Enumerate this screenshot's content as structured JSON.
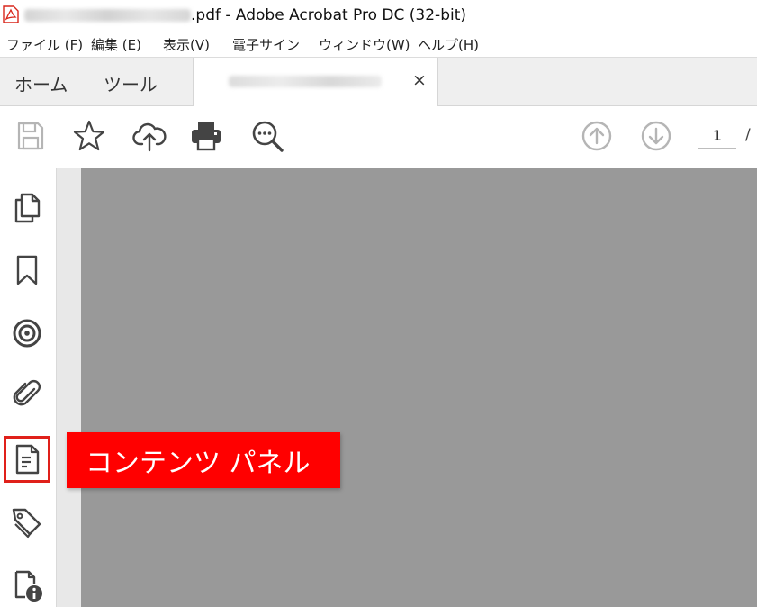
{
  "window": {
    "title": ".pdf - Adobe Acrobat Pro DC (32-bit)",
    "app_icon": "acrobat-icon"
  },
  "menu": [
    {
      "label": "ファイル (F)"
    },
    {
      "label": "編集 (E)"
    },
    {
      "label": "表示(V)"
    },
    {
      "label": "電子サイン"
    },
    {
      "label": "ウィンドウ(W)"
    },
    {
      "label": "ヘルプ(H)"
    }
  ],
  "tabs": {
    "home": "ホーム",
    "tools": "ツール",
    "close_symbol": "×"
  },
  "toolbar": {
    "icons": [
      "save-icon",
      "star-icon",
      "cloud-upload-icon",
      "print-icon",
      "search-zoom-icon",
      "page-up-icon",
      "page-down-icon"
    ],
    "page_number": "1",
    "page_separator": "/"
  },
  "sidebar": {
    "icons": [
      "page-thumbnails-icon",
      "bookmark-icon",
      "target-icon",
      "attachment-icon",
      "content-panel-icon",
      "tags-icon",
      "document-info-icon"
    ],
    "highlighted": "content-panel-icon"
  },
  "callout": {
    "text": "コンテンツ パネル"
  },
  "colors": {
    "accent": "#ff0000",
    "icon": "#444444",
    "icon_disabled": "#b5b5b5",
    "canvas": "#999999",
    "tab_bar": "#efefef"
  }
}
